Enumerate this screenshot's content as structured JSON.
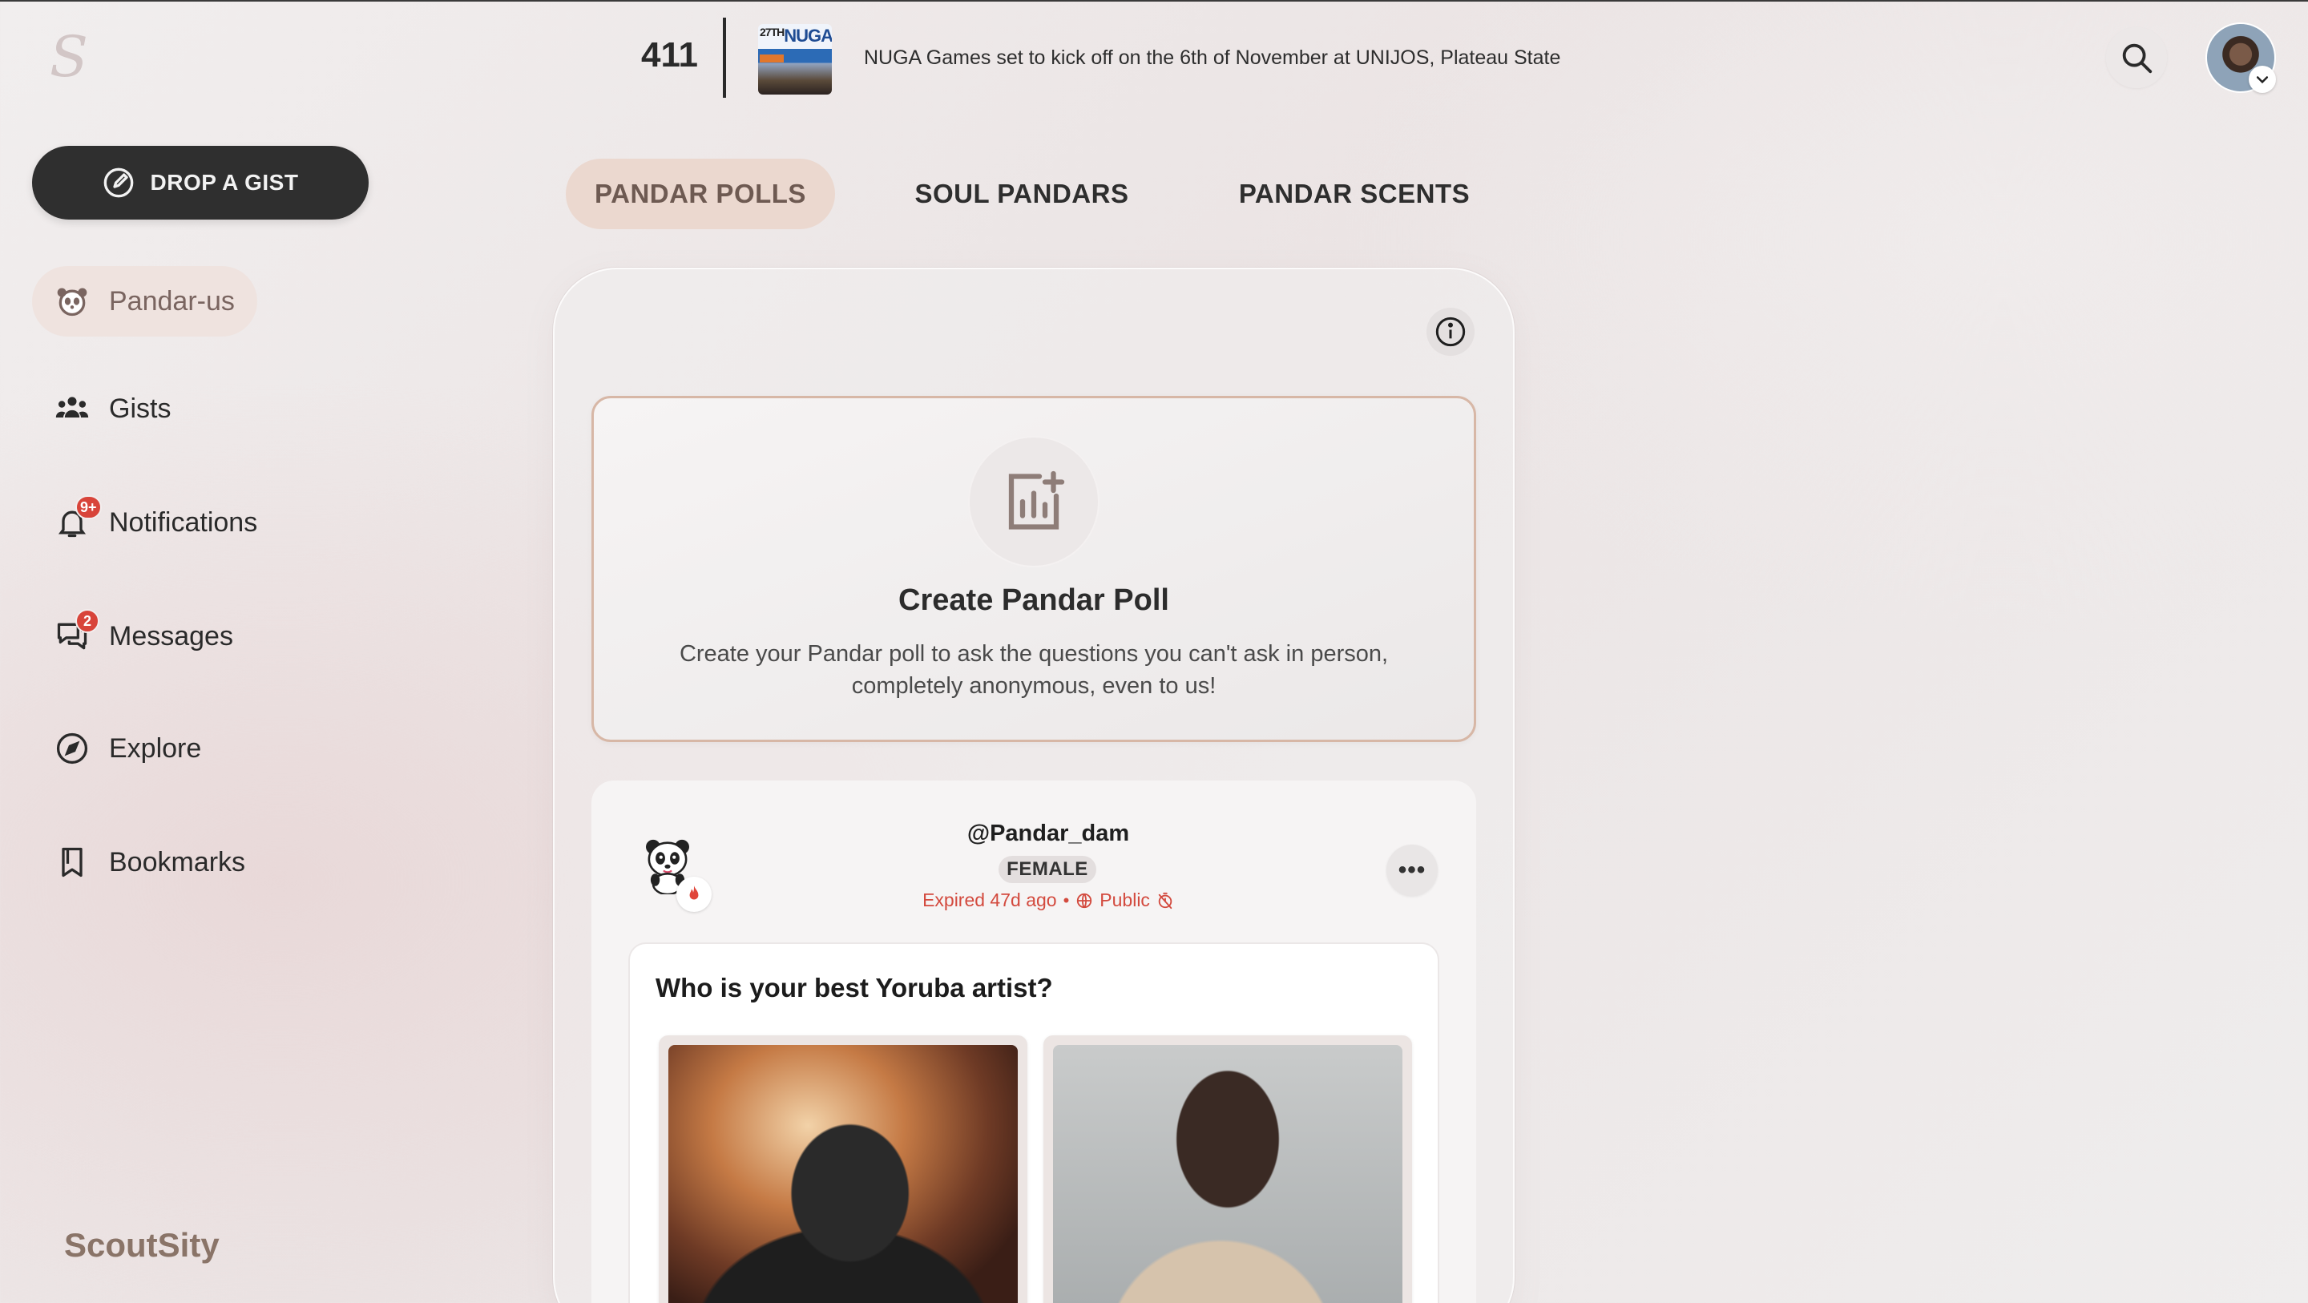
{
  "header": {
    "counter": "411",
    "news_headline": "NUGA Games set to kick off on the 6th of November at UNIJOS, Plateau State",
    "news_thumb_title": "NUGA",
    "news_thumb_edition": "27TH"
  },
  "sidebar": {
    "cta_label": "DROP A GIST",
    "items": [
      {
        "label": "Pandar-us",
        "icon": "panda-icon",
        "active": true
      },
      {
        "label": "Gists",
        "icon": "group-icon"
      },
      {
        "label": "Notifications",
        "icon": "bell-icon",
        "badge": "9+"
      },
      {
        "label": "Messages",
        "icon": "chat-icon",
        "badge": "2"
      },
      {
        "label": "Explore",
        "icon": "compass-icon"
      },
      {
        "label": "Bookmarks",
        "icon": "bookmark-icon"
      }
    ],
    "brand": "ScoutSity"
  },
  "tabs": [
    {
      "label": "PANDAR POLLS",
      "active": true
    },
    {
      "label": "SOUL PANDARS"
    },
    {
      "label": "PANDAR SCENTS"
    }
  ],
  "create_poll": {
    "title": "Create Pandar Poll",
    "description": "Create your Pandar poll to ask the questions you can't ask in person, completely anonymous, even to us!"
  },
  "post": {
    "username": "@Pandar_dam",
    "gender": "FEMALE",
    "status": "Expired 47d ago",
    "separator": "•",
    "visibility": "Public",
    "question": "Who is your best Yoruba artist?",
    "more_label": "•••"
  },
  "colors": {
    "accent": "#ebd8cf",
    "dark_button": "#2f2f2f",
    "alert": "#d34a3e",
    "card_border": "#d7b7a6"
  }
}
